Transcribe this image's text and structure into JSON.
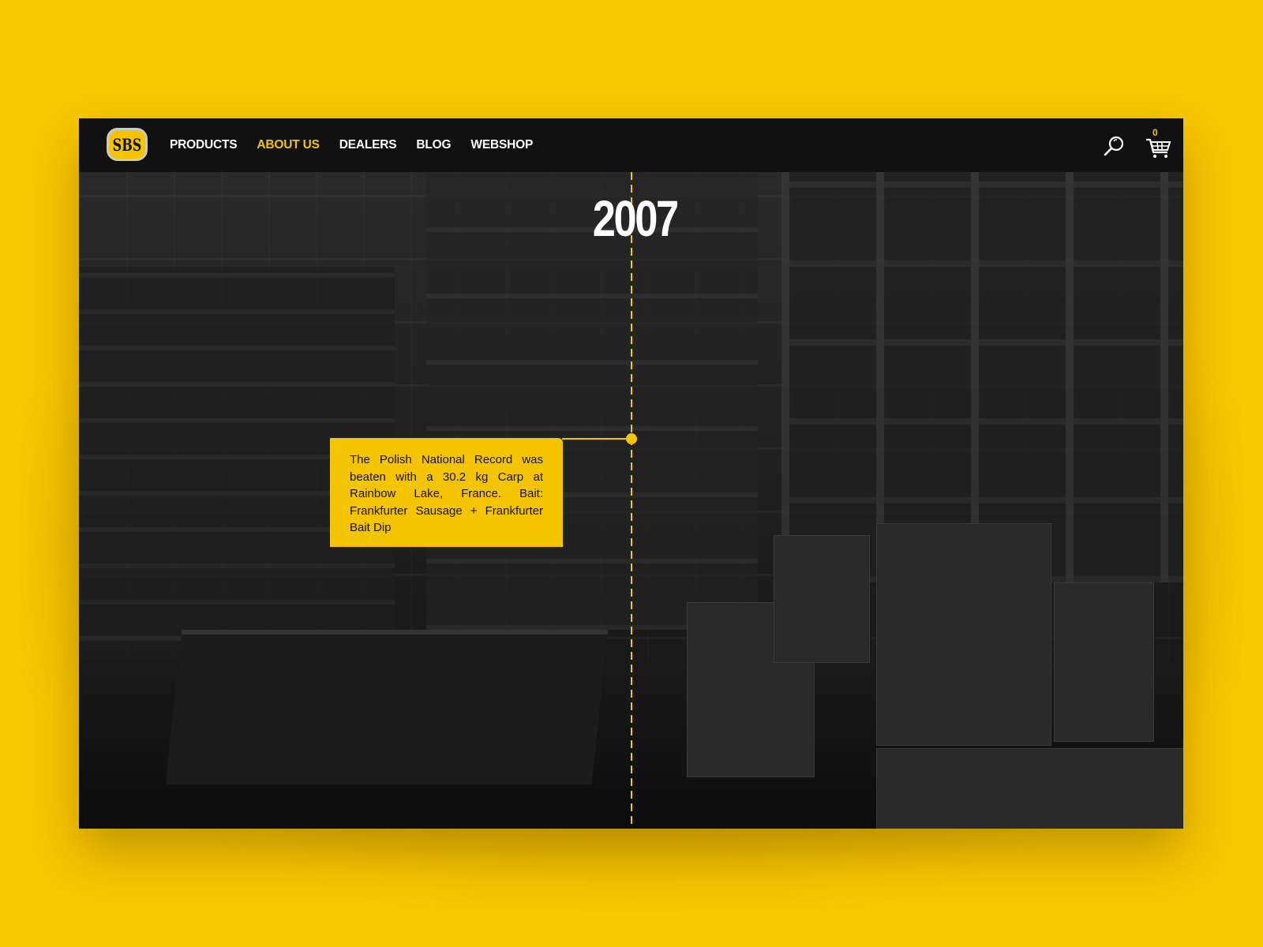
{
  "brand": {
    "logo_text": "SBS",
    "accent_color": "#f5c400",
    "background_color": "#f8c800"
  },
  "nav": {
    "items": [
      {
        "label": "PRODUCTS",
        "active": false
      },
      {
        "label": "ABOUT US",
        "active": true
      },
      {
        "label": "DEALERS",
        "active": false
      },
      {
        "label": "BLOG",
        "active": false
      },
      {
        "label": "WEBSHOP",
        "active": false
      }
    ]
  },
  "header_actions": {
    "search_icon": "search-icon",
    "cart_icon": "cart-icon",
    "cart_count": "0"
  },
  "timeline": {
    "year": "2007",
    "event_text": "The Polish National Record was beaten with a 30.2 kg Carp at Rainbow Lake, France. Bait: Frankfurter Sausage + Frankfurter Bait Dip"
  }
}
